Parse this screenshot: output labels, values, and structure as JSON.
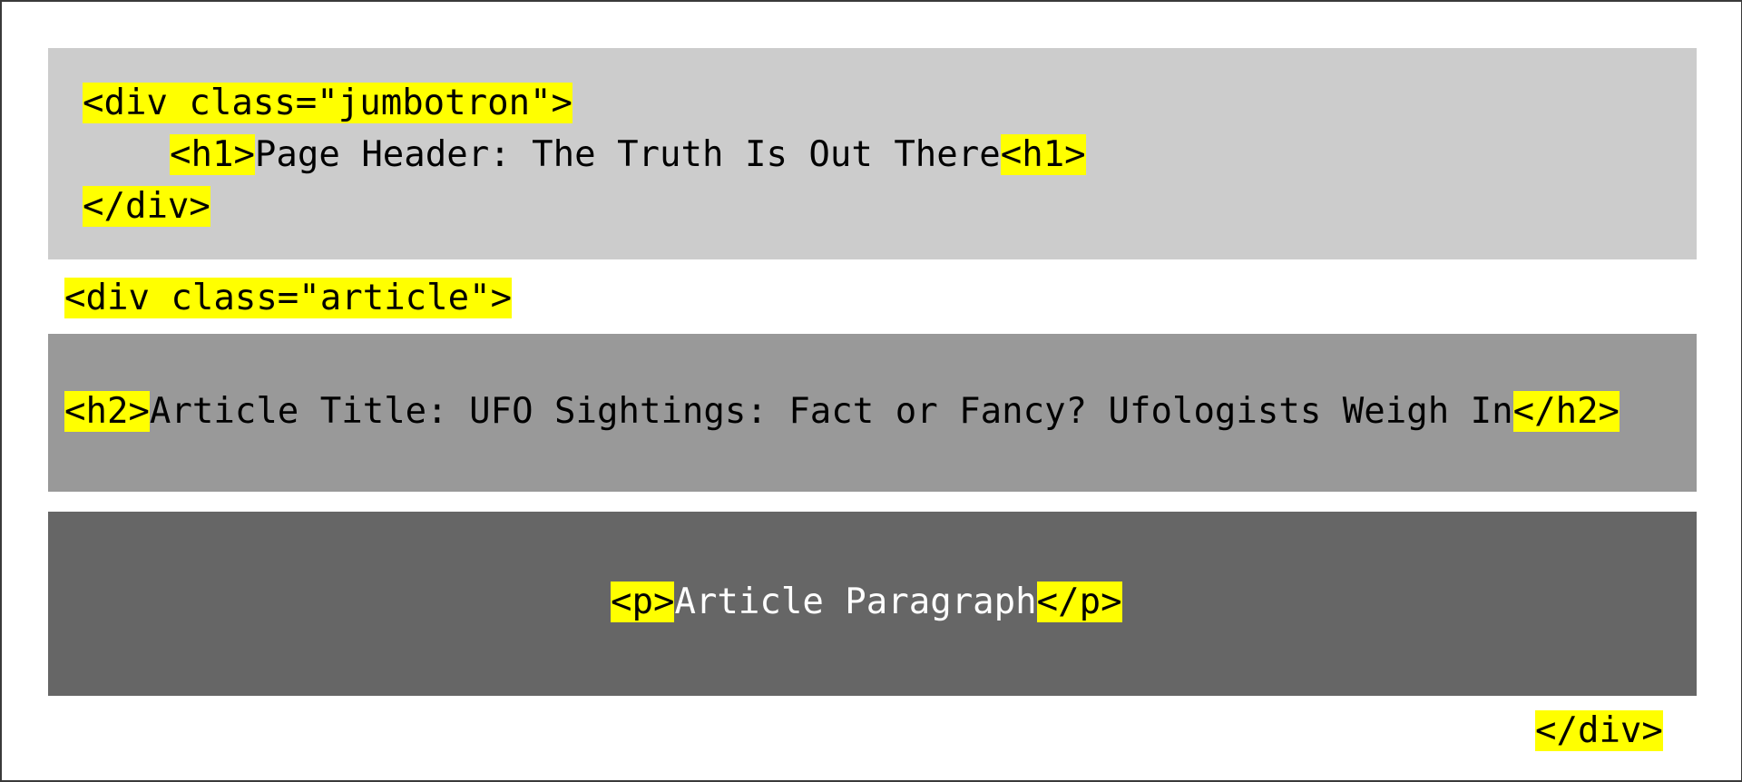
{
  "jumbotron": {
    "open_tag": "<div class=\"jumbotron\">",
    "h1_open": "<h1>",
    "h1_text": "Page Header: The Truth Is Out There",
    "h1_close": "<h1>",
    "close_tag": "</div>"
  },
  "article": {
    "open_tag": "<div class=\"article\">",
    "h2_open": "<h2>",
    "h2_text": "Article Title: UFO Sightings: Fact or Fancy? Ufologists Weigh In",
    "h2_close": "</h2>",
    "p_open": "<p>",
    "p_text": "Article Paragraph",
    "p_close": "</p>",
    "close_tag": "</div>"
  },
  "colors": {
    "tag_highlight": "#ffff00",
    "jumbotron_bg": "#cccccc",
    "h2_bg": "#999999",
    "p_bg": "#666666"
  }
}
